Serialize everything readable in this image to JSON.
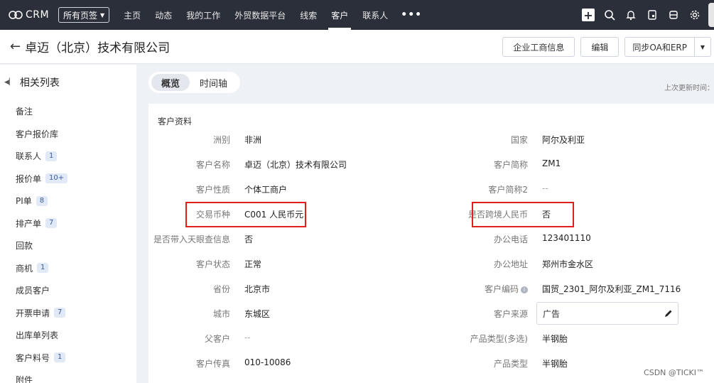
{
  "topbar": {
    "logo_text": "CRM",
    "page_select": "所有页签",
    "nav": [
      "主页",
      "动态",
      "我的工作",
      "外贸数据平台",
      "线索",
      "客户",
      "联系人"
    ],
    "active_nav": "客户",
    "more": "•••"
  },
  "header": {
    "title": "卓迈（北京）技术有限公司",
    "buttons": {
      "business_info": "企业工商信息",
      "edit": "编辑",
      "sync": "同步OA和ERP"
    }
  },
  "sidebar": {
    "title": "相关列表",
    "items": [
      {
        "label": "备注",
        "badge": ""
      },
      {
        "label": "客户报价库",
        "badge": ""
      },
      {
        "label": "联系人",
        "badge": "1"
      },
      {
        "label": "报价单",
        "badge": "10+"
      },
      {
        "label": "PI单",
        "badge": "8"
      },
      {
        "label": "排产单",
        "badge": "7"
      },
      {
        "label": "回款",
        "badge": ""
      },
      {
        "label": "商机",
        "badge": "1"
      },
      {
        "label": "成员客户",
        "badge": ""
      },
      {
        "label": "开票申请",
        "badge": "7"
      },
      {
        "label": "出库单列表",
        "badge": ""
      },
      {
        "label": "客户料号",
        "badge": "1"
      },
      {
        "label": "附件",
        "badge": ""
      }
    ]
  },
  "tabs": {
    "overview": "概览",
    "timeline": "时间轴"
  },
  "last_update": "上次更新时间：",
  "profile": {
    "section_title": "客户资料",
    "left": [
      {
        "label": "洲别",
        "value": "非洲"
      },
      {
        "label": "客户名称",
        "value": "卓迈（北京）技术有限公司"
      },
      {
        "label": "客户性质",
        "value": "个体工商户"
      },
      {
        "label": "交易币种",
        "value": "C001 人民币元"
      },
      {
        "label": "是否带入天眼查信息",
        "value": "否"
      },
      {
        "label": "客户状态",
        "value": "正常"
      },
      {
        "label": "省份",
        "value": "北京市"
      },
      {
        "label": "城市",
        "value": "东城区"
      },
      {
        "label": "父客户",
        "value": "--"
      },
      {
        "label": "客户传真",
        "value": "010-10086"
      }
    ],
    "right": [
      {
        "label": "国家",
        "value": "阿尔及利亚"
      },
      {
        "label": "客户简称",
        "value": "ZM1"
      },
      {
        "label": "客户简称2",
        "value": "--"
      },
      {
        "label": "是否跨境人民币",
        "value": "否"
      },
      {
        "label": "办公电话",
        "value": "123401110"
      },
      {
        "label": "办公地址",
        "value": "郑州市金水区"
      },
      {
        "label": "客户编码",
        "value": "国贸_2301_阿尔及利亚_ZM1_7116"
      },
      {
        "label": "客户来源",
        "value": "广告"
      },
      {
        "label": "产品类型(多选)",
        "value": "半钢胎"
      },
      {
        "label": "产品类型",
        "value": "半钢胎"
      }
    ]
  },
  "watermark": "CSDN @TICKI™",
  "colors": {
    "topbar": "#2b2f3a",
    "highlight": "#e0201b"
  }
}
